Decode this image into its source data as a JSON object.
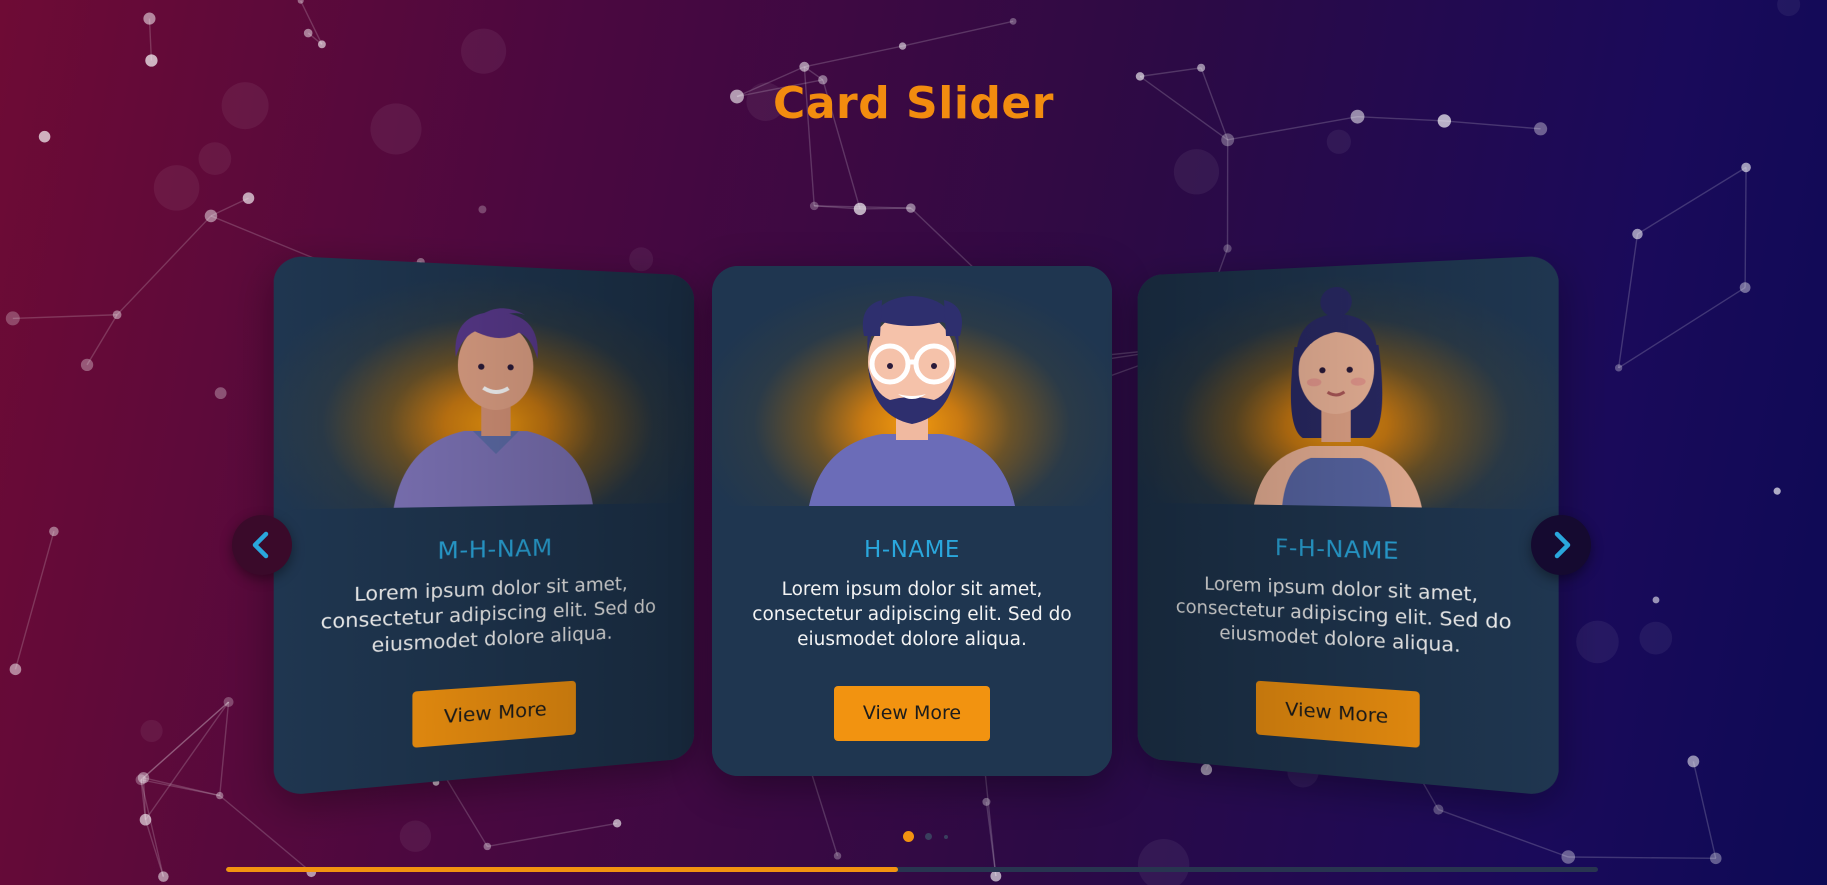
{
  "page": {
    "title": "Card Slider"
  },
  "cards": [
    {
      "name": "M-H-NAM",
      "description": "Lorem ipsum dolor sit amet, consectetur adipiscing elit. Sed do eiusmodet dolore aliqua.",
      "button_label": "View More",
      "avatar": "young-man-avatar"
    },
    {
      "name": "H-NAME",
      "description": "Lorem ipsum dolor sit amet, consectetur adipiscing elit. Sed do eiusmodet dolore aliqua.",
      "button_label": "View More",
      "avatar": "bearded-man-glasses-avatar"
    },
    {
      "name": "F-H-NAME",
      "description": "Lorem ipsum dolor sit amet, consectetur adipiscing elit. Sed do eiusmodet dolore aliqua.",
      "button_label": "View More",
      "avatar": "woman-bun-avatar"
    }
  ],
  "navigation": {
    "prev_icon": "chevron-left-icon",
    "next_icon": "chevron-right-icon"
  },
  "pagination": {
    "active_index": 0,
    "count": 3
  },
  "progress": {
    "value": 0.49
  },
  "colors": {
    "accent": "#f29310",
    "name_text": "#2aa7dc",
    "card_bg": "#1f3650"
  }
}
